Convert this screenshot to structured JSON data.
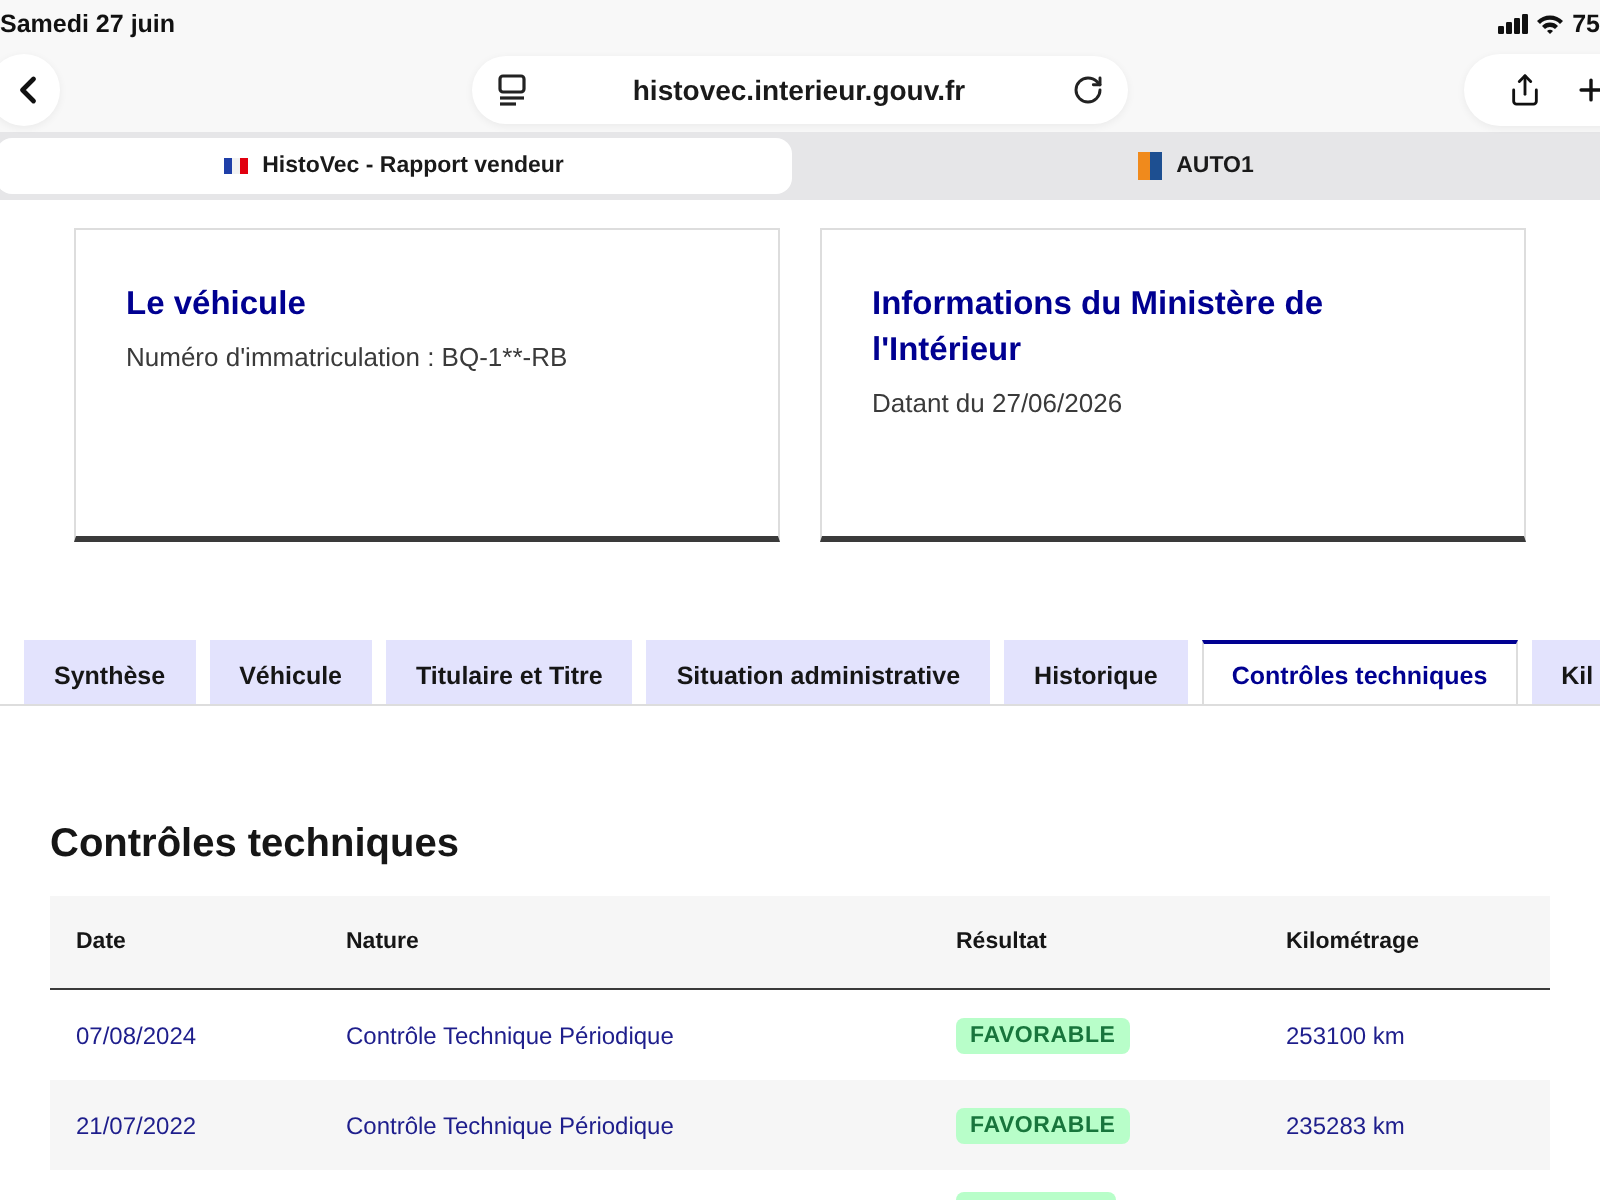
{
  "status_bar": {
    "date": "Samedi 27 juin",
    "battery": "75"
  },
  "browser": {
    "address": "histovec.interieur.gouv.fr",
    "tabs": [
      {
        "title": "HistoVec - Rapport vendeur",
        "kind": "flag",
        "selected": true
      },
      {
        "title": "AUTO1",
        "kind": "auto",
        "selected": false
      }
    ]
  },
  "cards": [
    {
      "title": "Le véhicule",
      "text": "Numéro d'immatriculation : BQ-1**-RB"
    },
    {
      "title": "Informations du Ministère de l'Intérieur",
      "text": "Datant du 27/06/2026"
    }
  ],
  "tabs": [
    {
      "label": "Synthèse",
      "selected": false
    },
    {
      "label": "Véhicule",
      "selected": false
    },
    {
      "label": "Titulaire et Titre",
      "selected": false
    },
    {
      "label": "Situation administrative",
      "selected": false
    },
    {
      "label": "Historique",
      "selected": false
    },
    {
      "label": "Contrôles techniques",
      "selected": true
    },
    {
      "label": "Kil",
      "selected": false
    }
  ],
  "section": {
    "title": "Contrôles techniques"
  },
  "table": {
    "columns": [
      "Date",
      "Nature",
      "Résultat",
      "Kilométrage"
    ],
    "rows": [
      {
        "date": "07/08/2024",
        "nature": "Contrôle Technique Périodique",
        "result": "FAVORABLE",
        "mileage": "253100 km"
      },
      {
        "date": "21/07/2022",
        "nature": "Contrôle Technique Périodique",
        "result": "FAVORABLE",
        "mileage": "235283 km"
      }
    ]
  }
}
